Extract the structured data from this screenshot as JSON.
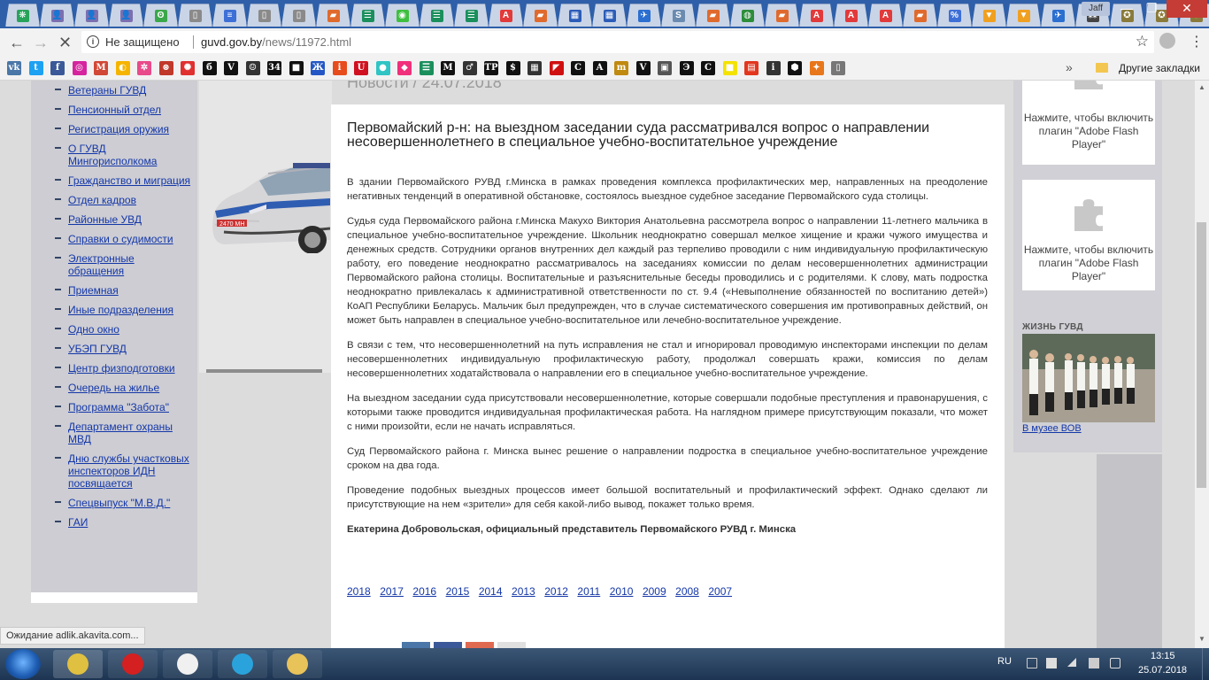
{
  "browser": {
    "tabs": [
      {
        "name": "tab-1",
        "glyph": "❋",
        "color": "#27a35a"
      },
      {
        "name": "tab-2",
        "glyph": "👤",
        "color": "#7b6fb0"
      },
      {
        "name": "tab-3",
        "glyph": "👤",
        "color": "#7b6fb0"
      },
      {
        "name": "tab-4",
        "glyph": "👤",
        "color": "#7b6fb0"
      },
      {
        "name": "tab-5",
        "glyph": "ʘ",
        "color": "#3aa84a"
      },
      {
        "name": "tab-6",
        "glyph": "▯",
        "color": "#8a8a8a"
      },
      {
        "name": "tab-7",
        "glyph": "≡",
        "color": "#3d6fd6"
      },
      {
        "name": "tab-8",
        "glyph": "▯",
        "color": "#8a8a8a"
      },
      {
        "name": "tab-9",
        "glyph": "▯",
        "color": "#8a8a8a"
      },
      {
        "name": "tab-10",
        "glyph": "▰",
        "color": "#e06a2d"
      },
      {
        "name": "tab-11",
        "glyph": "☰",
        "color": "#1a8f5c"
      },
      {
        "name": "tab-12",
        "glyph": "◉",
        "color": "#3fbf3f"
      },
      {
        "name": "tab-13",
        "glyph": "☰",
        "color": "#1a8f5c"
      },
      {
        "name": "tab-14",
        "glyph": "☰",
        "color": "#1a8f5c"
      },
      {
        "name": "tab-15",
        "glyph": "A",
        "color": "#e23a3a"
      },
      {
        "name": "tab-16",
        "glyph": "▰",
        "color": "#e06a2d"
      },
      {
        "name": "tab-17",
        "glyph": "▦",
        "color": "#2b5cb8"
      },
      {
        "name": "tab-18",
        "glyph": "▦",
        "color": "#2b5cb8"
      },
      {
        "name": "tab-19",
        "glyph": "✈",
        "color": "#2b6fd0"
      },
      {
        "name": "tab-20",
        "glyph": "S",
        "color": "#6a8ab0"
      },
      {
        "name": "tab-21",
        "glyph": "▰",
        "color": "#e06a2d"
      },
      {
        "name": "tab-22",
        "glyph": "◍",
        "color": "#2d8d3a"
      },
      {
        "name": "tab-23",
        "glyph": "▰",
        "color": "#e06a2d"
      },
      {
        "name": "tab-24",
        "glyph": "A",
        "color": "#e23a3a"
      },
      {
        "name": "tab-25",
        "glyph": "A",
        "color": "#e23a3a"
      },
      {
        "name": "tab-26",
        "glyph": "A",
        "color": "#e23a3a"
      },
      {
        "name": "tab-27",
        "glyph": "▰",
        "color": "#e06a2d"
      },
      {
        "name": "tab-28",
        "glyph": "%",
        "color": "#3d6fd6"
      },
      {
        "name": "tab-29",
        "glyph": "▼",
        "color": "#f0a020"
      },
      {
        "name": "tab-30",
        "glyph": "▼",
        "color": "#f0a020"
      },
      {
        "name": "tab-31",
        "glyph": "✈",
        "color": "#2b6fd0"
      },
      {
        "name": "tab-32",
        "glyph": "⁂",
        "color": "#444444"
      },
      {
        "name": "tab-33",
        "glyph": "✪",
        "color": "#8a7a3a"
      },
      {
        "name": "tab-34",
        "glyph": "✪",
        "color": "#8a7a3a"
      },
      {
        "name": "tab-35",
        "glyph": "✪",
        "color": "#8a7a3a"
      }
    ],
    "active_tab": {
      "glyph": "✪",
      "color": "#8a7a3a",
      "close": "×"
    },
    "user_badge": "Jaff",
    "window_controls": {
      "minimize": "—",
      "maximize": "❐",
      "close": "✕"
    },
    "nav": {
      "back": "←",
      "forward": "→",
      "stop": "✕"
    },
    "security_label": "Не защищено",
    "url_domain": "guvd.gov.by",
    "url_path": "/news/11972.html",
    "bookmarks": [
      {
        "glyph": "vk",
        "color": "#4a76a8"
      },
      {
        "glyph": "t",
        "color": "#1da1f2"
      },
      {
        "glyph": "f",
        "color": "#3b5998"
      },
      {
        "glyph": "◎",
        "color": "#d6249f"
      },
      {
        "glyph": "M",
        "color": "#d14836"
      },
      {
        "glyph": "◐",
        "color": "#f5b400"
      },
      {
        "glyph": "✲",
        "color": "#e84a8a"
      },
      {
        "glyph": "⊗",
        "color": "#c0392b"
      },
      {
        "glyph": "✺",
        "color": "#e03030"
      },
      {
        "glyph": "б",
        "color": "#111111"
      },
      {
        "glyph": "V",
        "color": "#111111"
      },
      {
        "glyph": "☺",
        "color": "#333333"
      },
      {
        "glyph": "34",
        "color": "#111111"
      },
      {
        "glyph": "■",
        "color": "#111111"
      },
      {
        "glyph": "Ж",
        "color": "#2457c5"
      },
      {
        "glyph": "i",
        "color": "#e74c1c"
      },
      {
        "glyph": "U",
        "color": "#d01020"
      },
      {
        "glyph": "●",
        "color": "#31c4c4"
      },
      {
        "glyph": "◆",
        "color": "#f0307a"
      },
      {
        "glyph": "☰",
        "color": "#1a8f5c"
      },
      {
        "glyph": "M",
        "color": "#111111"
      },
      {
        "glyph": "♂",
        "color": "#333333"
      },
      {
        "glyph": "TP",
        "color": "#111111"
      },
      {
        "glyph": "$",
        "color": "#111111"
      },
      {
        "glyph": "▦",
        "color": "#333333"
      },
      {
        "glyph": "◤",
        "color": "#d01010"
      },
      {
        "glyph": "C",
        "color": "#111111"
      },
      {
        "glyph": "A",
        "color": "#111111"
      },
      {
        "glyph": "m",
        "color": "#c08a10"
      },
      {
        "glyph": "V",
        "color": "#111111"
      },
      {
        "glyph": "▣",
        "color": "#555555"
      },
      {
        "glyph": "Э",
        "color": "#111111"
      },
      {
        "glyph": "C",
        "color": "#111111"
      },
      {
        "glyph": "■",
        "color": "#f4e200"
      },
      {
        "glyph": "▤",
        "color": "#e2371e"
      },
      {
        "glyph": "i",
        "color": "#333333"
      },
      {
        "glyph": "⬢",
        "color": "#111111"
      },
      {
        "glyph": "✦",
        "color": "#e8761a"
      },
      {
        "glyph": "▯",
        "color": "#777777"
      }
    ],
    "bookmarks_more": "»",
    "other_bookmarks": "Другие закладки",
    "status_text": "Ожидание adlik.akavita.com..."
  },
  "sidebar": {
    "items": [
      {
        "label": "Ветераны ГУВД"
      },
      {
        "label": "Пенсионный отдел"
      },
      {
        "label": "Регистрация оружия"
      },
      {
        "label": "О ГУВД Мингорисполкома"
      },
      {
        "label": "Гражданство и миграция"
      },
      {
        "label": "Отдел кадров"
      },
      {
        "label": "Районные УВД"
      },
      {
        "label": "Справки о судимости"
      },
      {
        "label": "Электронные обращения"
      },
      {
        "label": "Приемная"
      },
      {
        "label": "Иные подразделения"
      },
      {
        "label": "Одно окно"
      },
      {
        "label": "УБЭП ГУВД"
      },
      {
        "label": "Центр физподготовки"
      },
      {
        "label": "Очередь на жилье"
      },
      {
        "label": "Программа \"Забота\""
      },
      {
        "label": "Департамент охраны МВД"
      },
      {
        "label": "Дню службы участковых инспекторов ИДН посвящается"
      },
      {
        "label": "Спецвыпуск \"М.В.Д.\""
      },
      {
        "label": "ГАИ"
      }
    ]
  },
  "car": {
    "plate": "2470 MH"
  },
  "news": {
    "heading": "Новости / 24.07.2018",
    "title": "Первомайский р-н: на выездном заседании суда рассматривался вопрос о направлении несовершеннолетнего в специальное учебно-воспитательное учреждение",
    "paragraphs": [
      "В здании Первомайского РУВД г.Минска в рамках проведения комплекса профилактических мер, направленных на преодоление негативных тенденций в оперативной обстановке, состоялось выездное судебное заседание Первомайского суда столицы.",
      "Судья суда Первомайского района г.Минска Макухо Виктория Анатольевна рассмотрела вопрос о направлении 11-летнего мальчика в специальное учебно-воспитательное учреждение. Школьник неоднократно совершал мелкое хищение и кражи чужого имущества и денежных средств. Сотрудники органов внутренних дел каждый раз терпеливо проводили с ним индивидуальную профилактическую работу, его поведение неоднократно рассматривалось на заседаниях комиссии по делам несовершеннолетних администрации Первомайского района столицы. Воспитательные и разъяснительные беседы проводились и с родителями. К слову, мать подростка неоднократно привлекалась к административной ответственности по ст. 9.4 («Невыполнение обязанностей по воспитанию детей») КоАП Республики Беларусь. Мальчик был предупрежден, что в случае систематического совершения им противоправных действий, он может быть направлен в специальное учебно-воспитательное или лечебно-воспитательное учреждение.",
      "В связи с тем, что несовершеннолетний на путь исправления не стал и игнорировал проводимую инспекторами инспекции по делам несовершеннолетних индивидуальную профилактическую работу, продолжал совершать кражи, комиссия по делам несовершеннолетних ходатайствовала о направлении его в специальное учебно-воспитательное учреждение.",
      "На выездном заседании суда присутствовали несовершеннолетние, которые совершали подобные преступления и правонарушения, с которыми также проводится индивидуальная профилактическая работа. На наглядном примере присутствующим показали, что может с ними произойти, если не начать исправляться.",
      "Суд Первомайского района г. Минска вынес решение о направлении подростка в специальное учебно-воспитательное учреждение сроком на два года.",
      "Проведение подобных выездных процессов имеет большой воспитательный и профилактический эффект. Однако сделают ли присутствующие на нем «зрители» для себя какой-либо вывод, покажет только время."
    ],
    "author": "Екатерина Добровольская, официальный представитель Первомайского РУВД г. Минска",
    "years": [
      "2018",
      "2017",
      "2016",
      "2015",
      "2014",
      "2013",
      "2012",
      "2011",
      "2010",
      "2009",
      "2008",
      "2007"
    ]
  },
  "right": {
    "flash_message": "Нажмите, чтобы включить плагин \"Adobe Flash Player\"",
    "life_label": "ЖИЗНЬ ГУВД",
    "life_link": "В музее ВОВ"
  },
  "taskbar": {
    "language": "RU",
    "time": "13:15",
    "date": "25.07.2018",
    "apps": [
      {
        "name": "chrome",
        "color": "#e0c040"
      },
      {
        "name": "red-app",
        "color": "#d42020"
      },
      {
        "name": "slack",
        "color": "#f0f0f0"
      },
      {
        "name": "telegram",
        "color": "#2aa3dc"
      },
      {
        "name": "explorer",
        "color": "#e8c35a"
      }
    ]
  }
}
